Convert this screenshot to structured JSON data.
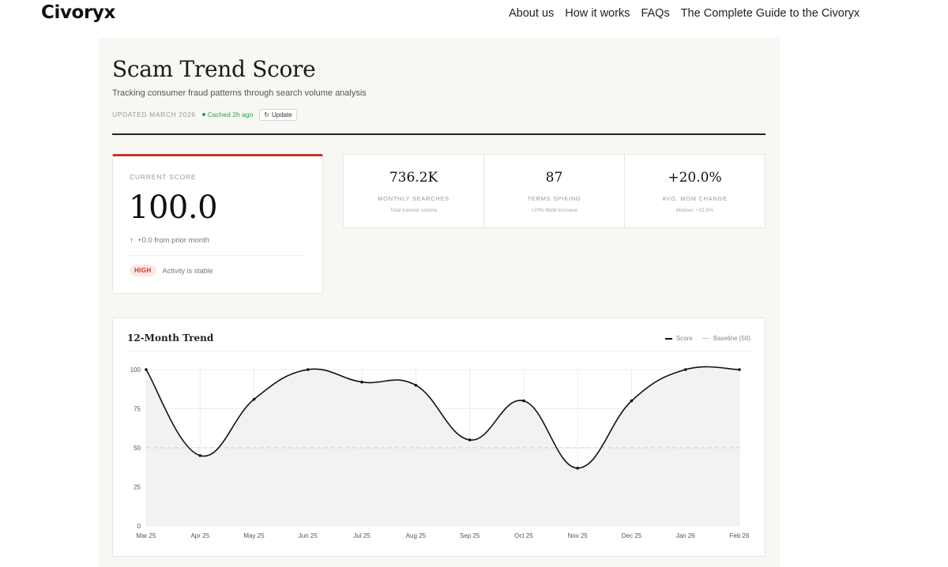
{
  "nav": {
    "brand": "Civoryx",
    "links": [
      "About us",
      "How it works",
      "FAQs",
      "The Complete Guide to the Civoryx"
    ]
  },
  "header": {
    "title": "Scam Trend Score",
    "subtitle": "Tracking consumer fraud patterns through search volume analysis",
    "updated": "UPDATED MARCH 2026",
    "cached": "Cached 2h ago",
    "update_label": "Update"
  },
  "score": {
    "label": "CURRENT SCORE",
    "value": "100.0",
    "delta": "+0.0 from prior month",
    "badge": "HIGH",
    "status": "Activity is stable"
  },
  "stats": [
    {
      "value": "736.2K",
      "label": "MONTHLY SEARCHES",
      "sub": "Total tracked volume"
    },
    {
      "value": "87",
      "label": "TERMS SPIKING",
      "sub": ">20% MoM increase"
    },
    {
      "value": "+20.0%",
      "label": "AVG. MOM CHANGE",
      "sub": "Median: +21.8%"
    }
  ],
  "chart": {
    "title": "12-Month Trend",
    "legend": {
      "score": "Score",
      "baseline": "Baseline (50)"
    }
  },
  "colors": {
    "accent": "#c0392b",
    "positive": "#2e9e55",
    "line": "#111111",
    "area": "#f2f2f2",
    "grid": "#ececec",
    "baseline": "#cccccc"
  },
  "chart_data": {
    "type": "line",
    "categories": [
      "Mar 25",
      "Apr 25",
      "May 25",
      "Jun 25",
      "Jul 25",
      "Aug 25",
      "Sep 25",
      "Oct 25",
      "Nov 25",
      "Dec 25",
      "Jan 26",
      "Feb 26"
    ],
    "series": [
      {
        "name": "Score",
        "values": [
          100,
          45,
          81,
          100,
          92,
          90,
          55,
          80,
          37,
          80,
          100,
          100
        ]
      },
      {
        "name": "Baseline (50)",
        "values": [
          50,
          50,
          50,
          50,
          50,
          50,
          50,
          50,
          50,
          50,
          50,
          50
        ]
      }
    ],
    "y_ticks": [
      0,
      25,
      50,
      75,
      100
    ],
    "ylim": [
      0,
      100
    ],
    "grid": true,
    "legend_position": "top-right"
  }
}
